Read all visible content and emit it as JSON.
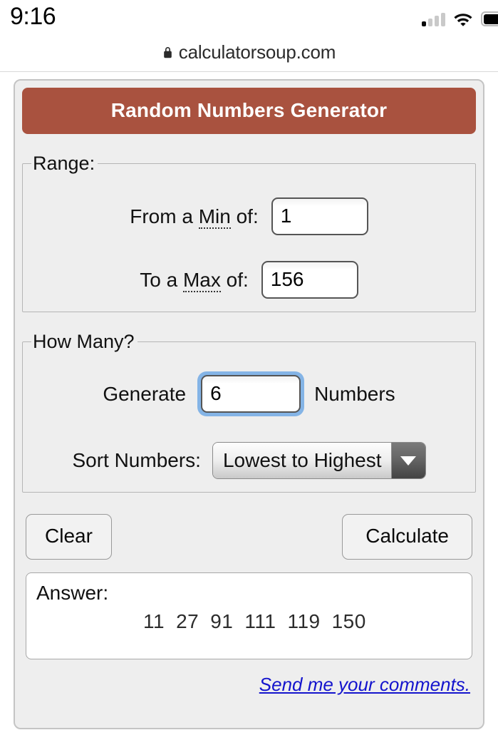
{
  "status_bar": {
    "time": "9:16",
    "icons": {
      "signal": "signal-bars-icon",
      "wifi": "wifi-icon",
      "battery": "battery-icon"
    },
    "signal_bars_filled": 1,
    "signal_bars_total": 4
  },
  "browser": {
    "lock_icon": "lock-icon",
    "url": "calculatorsoup.com"
  },
  "calculator": {
    "title": "Random Numbers Generator",
    "accent_color": "#a9523f",
    "range": {
      "legend": "Range:",
      "min_label_prefix": "From a ",
      "min_label_abbr": "Min",
      "min_label_suffix": " of:",
      "min_value": "1",
      "min_placeholder": "",
      "max_label_prefix": "To a ",
      "max_label_abbr": "Max",
      "max_label_suffix": " of:",
      "max_value": "156",
      "max_placeholder": ""
    },
    "how_many": {
      "legend": "How Many?",
      "generate_label": "Generate",
      "generate_value": "6",
      "generate_placeholder": "",
      "numbers_label": "Numbers",
      "sort_label": "Sort Numbers:",
      "sort_selected": "Lowest to Highest",
      "sort_arrow_icon": "chevron-down-icon",
      "focus_ring_color": "#84b4e6"
    },
    "buttons": {
      "clear": "Clear",
      "calculate": "Calculate"
    },
    "answer": {
      "label": "Answer:",
      "values": [
        "11",
        "27",
        "91",
        "111",
        "119",
        "150"
      ]
    },
    "comments_link": "Send me your comments."
  }
}
